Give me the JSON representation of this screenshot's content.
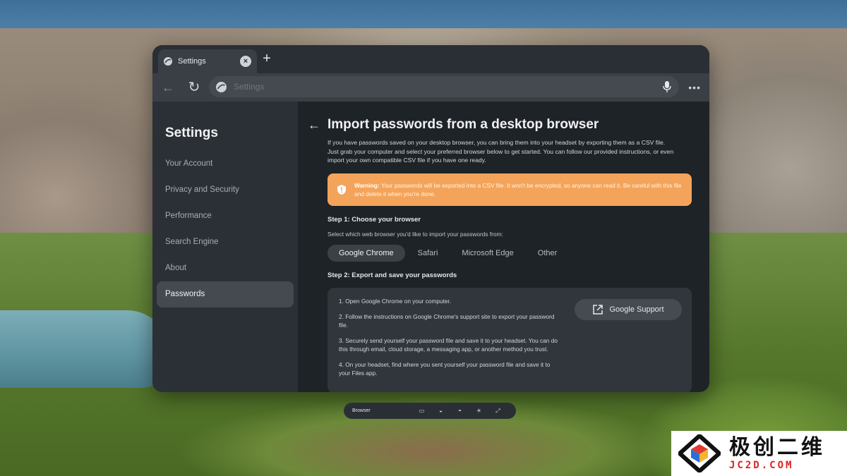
{
  "browser": {
    "tab_title": "Settings",
    "address_placeholder": "Settings"
  },
  "sidebar": {
    "title": "Settings",
    "items": [
      {
        "label": "Your Account"
      },
      {
        "label": "Privacy and Security"
      },
      {
        "label": "Performance"
      },
      {
        "label": "Search Engine"
      },
      {
        "label": "About"
      },
      {
        "label": "Passwords"
      }
    ],
    "active_index": 5
  },
  "main": {
    "title": "Import passwords from a desktop browser",
    "intro": "If you have passwords saved on your desktop browser, you can bring them into your headset by exporting them as a CSV file. Just grab your computer and select your preferred browser below to get started. You can follow our provided instructions, or even import your own compatible CSV file if you have one ready.",
    "warning": {
      "label": "Warning:",
      "text": " Your passwords will be exported into a CSV file. It won't be encrypted, so anyone can read it. Be careful with this file and delete it when you're done.",
      "color": "#f4a45a"
    },
    "step1": {
      "heading": "Step 1: Choose your browser",
      "sub": "Select which web browser you'd like to import your passwords from:",
      "tabs": [
        "Google Chrome",
        "Safari",
        "Microsoft Edge",
        "Other"
      ],
      "selected": "Google Chrome"
    },
    "step2": {
      "heading": "Step 2: Export and save your passwords",
      "instructions": [
        "1. Open Google Chrome on your computer.",
        "2. Follow the instructions on Google Chrome's support site to export your password file.",
        "3. Securely send yourself your password file and save it to your headset. You can do this through email, cloud storage, a messaging app, or another method you trust.",
        "4. On your headset, find where you sent yourself your password file and save it to your Files app."
      ],
      "support_button": "Google Support"
    }
  },
  "dock": {
    "label": "Browser",
    "icons": [
      "monitor-icon",
      "headset-icon",
      "controller-icon",
      "brightness-icon",
      "expand-icon"
    ]
  },
  "watermark": {
    "cn": "极创二维",
    "en": "JC2D.COM"
  }
}
